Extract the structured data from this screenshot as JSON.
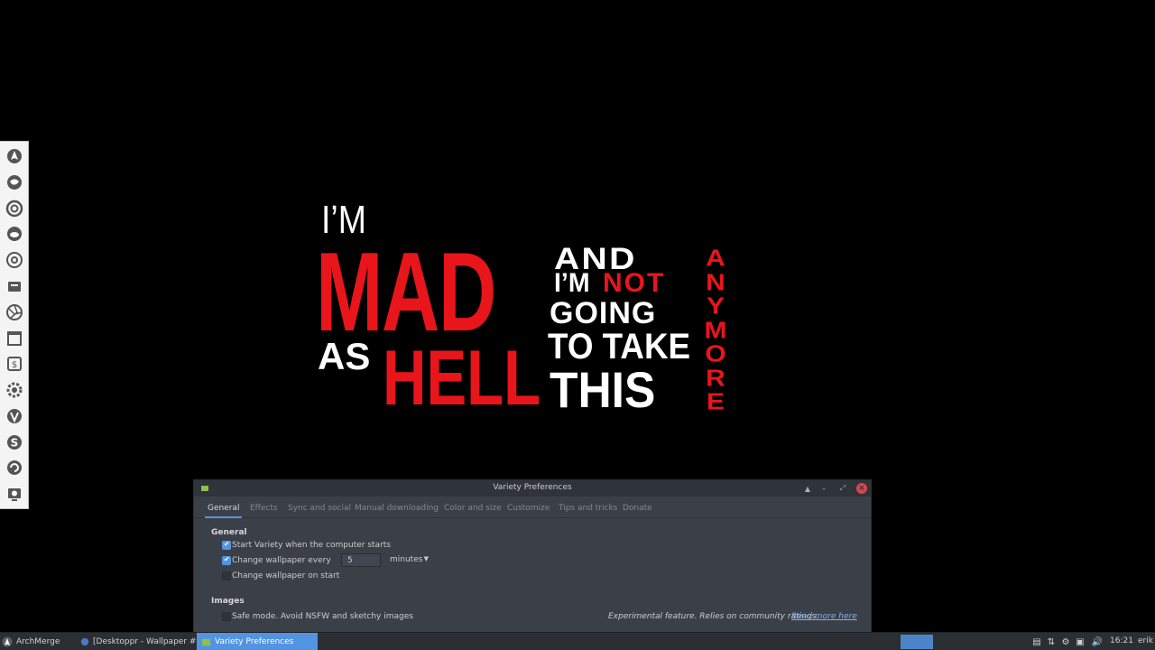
{
  "wallpaper": {
    "line_im": "I’M",
    "mad": "MAD",
    "and": "AND",
    "im_not_im": "I’M",
    "not": "NOT",
    "going": "GOING",
    "to_take": "TO TAKE",
    "as": "AS",
    "hell": "HELL",
    "this": "THIS",
    "anymore_letters": [
      "A",
      "N",
      "Y",
      "M",
      "O",
      "R",
      "E"
    ],
    "colors": {
      "white": "#ffffff",
      "red": "#e8151b"
    }
  },
  "dock": {
    "items": [
      "archmerge-icon",
      "firefox-icon",
      "debian-swirl-icon",
      "cat-icon",
      "chromium-icon",
      "files-icon",
      "aperture-icon",
      "window-icon",
      "dollar-terminal-icon",
      "settings-gear-icon",
      "vivaldi-icon",
      "skype-icon",
      "refresh-icon",
      "screenshot-icon"
    ]
  },
  "window": {
    "title": "Variety Preferences",
    "tabs": [
      "General",
      "Effects",
      "Sync and social",
      "Manual downloading",
      "Color and size",
      "Customize",
      "Tips and tricks",
      "Donate"
    ],
    "active_tab": "General",
    "general": {
      "heading": "General",
      "start_on_boot": "Start Variety when the computer starts",
      "change_every": "Change wallpaper every",
      "interval_value": "5",
      "interval_unit": "minutes",
      "change_on_start": "Change wallpaper on start"
    },
    "images": {
      "heading": "Images",
      "safe_mode": "Safe mode. Avoid NSFW and sketchy images",
      "experimental_note": "Experimental feature. Relies on community ratings.",
      "read_more": "Read more here"
    }
  },
  "taskbar": {
    "start_label": "ArchMerge",
    "tasks": [
      {
        "label": "[Desktoppr - Wallpaper #...",
        "active": false
      },
      {
        "label": "Variety Preferences",
        "active": true
      }
    ],
    "clock": "16:21",
    "user": "erik",
    "accent": "#5294e2"
  }
}
